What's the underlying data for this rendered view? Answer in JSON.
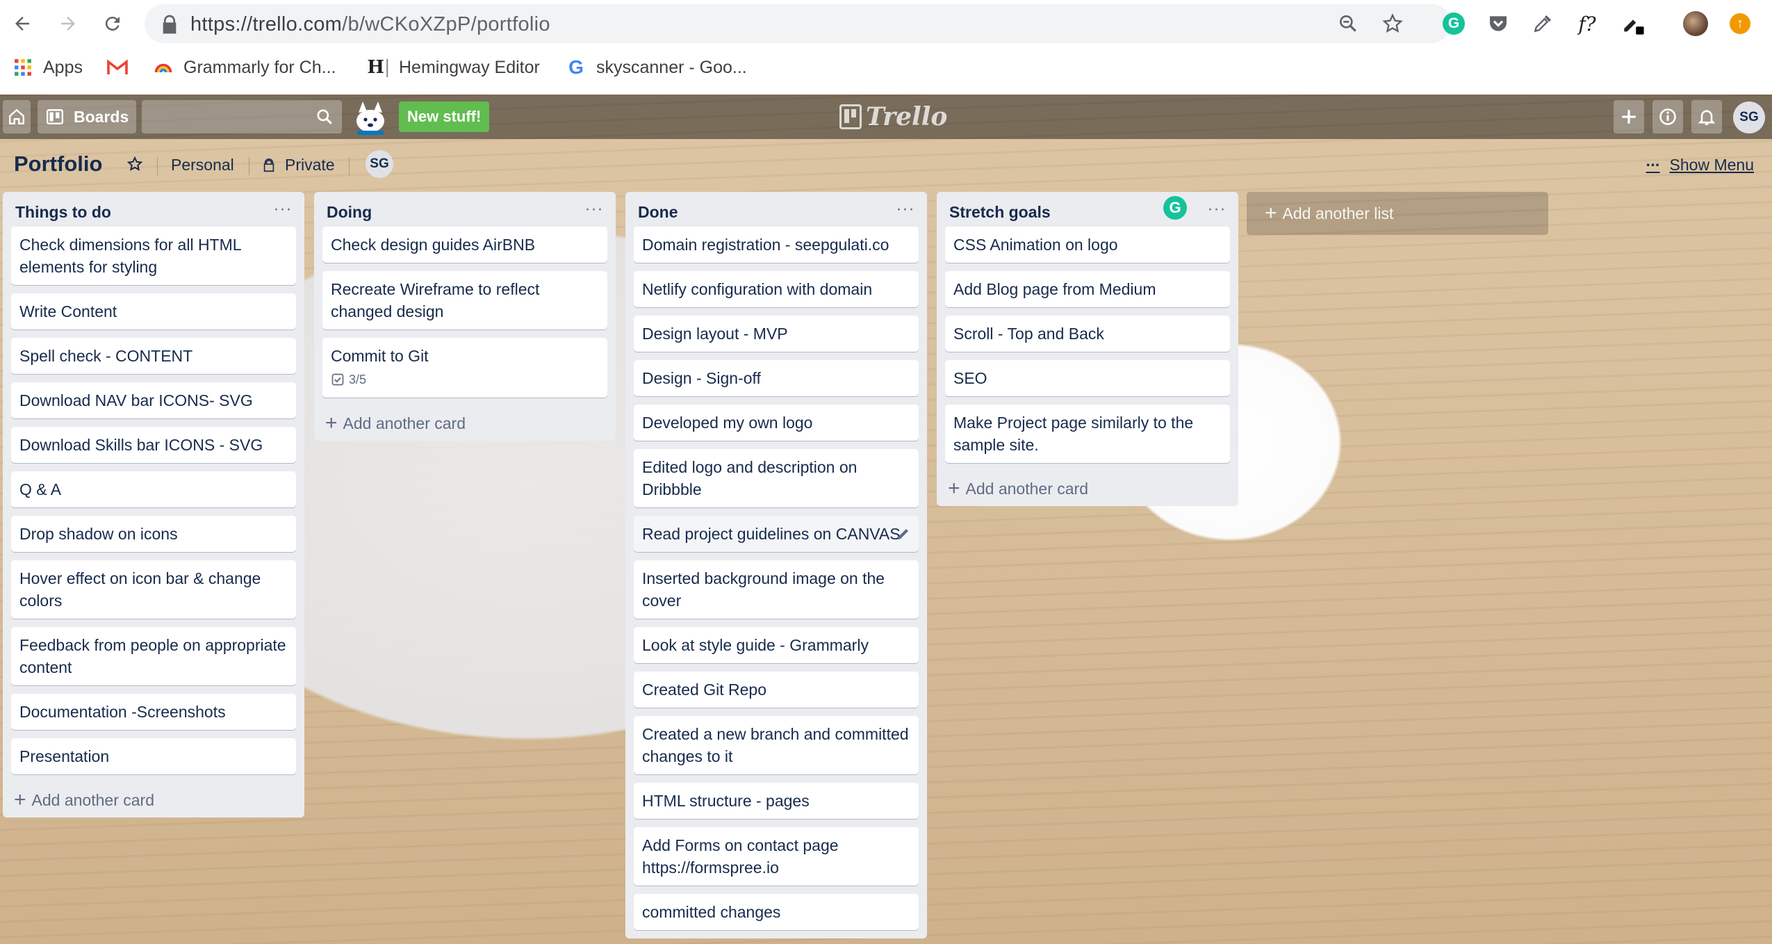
{
  "browser": {
    "url_host": "https://trello.com",
    "url_path": "/b/wCKoXZpP/portfolio",
    "bookmarks": [
      {
        "icon": "apps-grid-icon",
        "label": "Apps"
      },
      {
        "icon": "gmail-icon",
        "label": ""
      },
      {
        "icon": "grammarly-rainbow-icon",
        "label": "Grammarly for Ch..."
      },
      {
        "icon": "hemingway-icon",
        "label": "Hemingway Editor"
      },
      {
        "icon": "google-icon",
        "label": "skyscanner - Goo..."
      }
    ],
    "colors": {
      "grammarly": "#15c39a",
      "update": "#f29900"
    }
  },
  "topbar": {
    "boards_label": "Boards",
    "new_stuff_label": "New stuff!",
    "logo_text": "Trello",
    "user_initials": "SG"
  },
  "board": {
    "title": "Portfolio",
    "team": "Personal",
    "visibility": "Private",
    "member_initials": "SG",
    "show_menu_label": "Show Menu",
    "menu_dots": "···"
  },
  "lists": [
    {
      "title": "Things to do",
      "cards": [
        {
          "text": "Check dimensions for all HTML elements for styling"
        },
        {
          "text": "Write Content"
        },
        {
          "text": "Spell check - CONTENT"
        },
        {
          "text": "Download NAV bar ICONS- SVG"
        },
        {
          "text": "Download Skills bar ICONS - SVG"
        },
        {
          "text": "Q & A"
        },
        {
          "text": "Drop shadow on icons"
        },
        {
          "text": "Hover effect on icon bar & change colors"
        },
        {
          "text": "Feedback from people on appropriate content"
        },
        {
          "text": "Documentation -Screenshots"
        },
        {
          "text": "Presentation"
        }
      ],
      "add_card_label": "Add another card"
    },
    {
      "title": "Doing",
      "cards": [
        {
          "text": "Check design guides AirBNB"
        },
        {
          "text": "Recreate Wireframe to reflect changed design"
        },
        {
          "text": "Commit to Git",
          "checklist": "3/5"
        }
      ],
      "add_card_label": "Add another card"
    },
    {
      "title": "Done",
      "cards": [
        {
          "text": "Domain registration - seepgulati.co"
        },
        {
          "text": "Netlify configuration with domain"
        },
        {
          "text": "Design layout - MVP"
        },
        {
          "text": "Design - Sign-off"
        },
        {
          "text": "Developed my own logo"
        },
        {
          "text": "Edited logo and description on Dribbble"
        },
        {
          "text": "Read project guidelines on CANVAS",
          "editing": true
        },
        {
          "text": "Inserted background image on the cover"
        },
        {
          "text": "Look at style guide - Grammarly"
        },
        {
          "text": "Created Git Repo"
        },
        {
          "text": "Created a new branch and committed changes to it"
        },
        {
          "text": "HTML structure - pages"
        },
        {
          "text": "Add Forms on contact page https://formspree.io"
        },
        {
          "text": "committed changes"
        }
      ]
    },
    {
      "title": "Stretch goals",
      "cards": [
        {
          "text": "CSS Animation on logo"
        },
        {
          "text": "Add Blog page from Medium"
        },
        {
          "text": "Scroll - Top and Back"
        },
        {
          "text": "SEO"
        },
        {
          "text": "Make Project page similarly to the sample site."
        }
      ],
      "add_card_label": "Add another card"
    }
  ],
  "add_list_label": "Add another list"
}
